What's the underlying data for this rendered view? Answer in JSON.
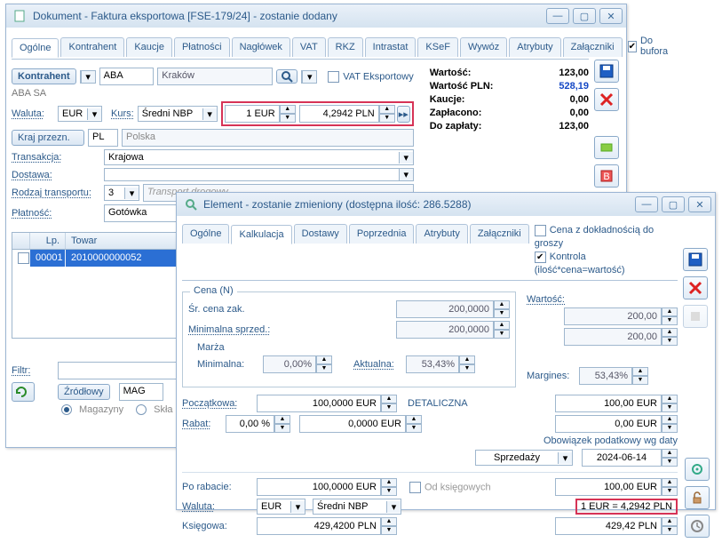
{
  "win1": {
    "title": "Dokument - Faktura eksportowa [FSE-179/24]  - zostanie dodany",
    "do_bufora_label": "Do bufora",
    "do_bufora_checked": true,
    "tabs": [
      "Ogólne",
      "Kontrahent",
      "Kaucje",
      "Płatności",
      "Nagłówek",
      "VAT",
      "RKZ",
      "Intrastat",
      "KSeF",
      "Wywóz",
      "Atrybuty",
      "Załączniki"
    ],
    "active_tab": 0,
    "kontrahent_btn": "Kontrahent",
    "kontrahent_value": "ABA",
    "kontrahent_city": "Kraków",
    "vat_eksportowy_label": "VAT Eksportowy",
    "aba_full": "ABA SA",
    "waluta_label": "Waluta:",
    "waluta_value": "EUR",
    "kurs_label": "Kurs:",
    "kurs_type": "Średni NBP",
    "kurs_amt": "1 EUR",
    "kurs_rate": "4,2942 PLN",
    "kraj_btn": "Kraj przezn.",
    "kraj_code": "PL",
    "kraj_name": "Polska",
    "transakcja_label": "Transakcja:",
    "transakcja_value": "Krajowa",
    "dostawa_label": "Dostawa:",
    "dostawa_value": "",
    "rodzaj_label": "Rodzaj transportu:",
    "rodzaj_value": "3",
    "rodzaj_desc": "Transport drogowy",
    "platnosc_label": "Płatność:",
    "platnosc_value": "Gotówka",
    "summary": {
      "wartosc_lbl": "Wartość:",
      "wartosc": "123,00",
      "wartosc_pln_lbl": "Wartość PLN:",
      "wartosc_pln": "528,19",
      "kaucje_lbl": "Kaucje:",
      "kaucje": "0,00",
      "zaplacono_lbl": "Zapłacono:",
      "zaplacono": "0,00",
      "do_zaplaty_lbl": "Do zapłaty:",
      "do_zaplaty": "123,00"
    },
    "grid": {
      "cols": {
        "lp": "Lp.",
        "towar": "Towar"
      },
      "row": {
        "lp": "00001",
        "towar": "2010000000052"
      }
    },
    "filtr_label": "Filtr:",
    "src_btn": "Źródłowy",
    "mag_label": "MAG",
    "magazyny_label": "Magazyny",
    "sklady_label": "Skła"
  },
  "win2": {
    "title": "Element - zostanie zmieniony (dostępna ilość: 286.5288)",
    "opt1_label": "Cena z dokładnością do groszy",
    "opt1_checked": false,
    "opt2_label": "Kontrola (ilość*cena=wartość)",
    "opt2_checked": true,
    "tabs": [
      "Ogólne",
      "Kalkulacja",
      "Dostawy",
      "Poprzednia",
      "Atrybuty",
      "Załączniki"
    ],
    "active_tab": 1,
    "cena_n_legend": "Cena (N)",
    "wartosc_lbl": "Wartość:",
    "sr_cena_lbl": "Śr. cena zak.",
    "sr_cena": "200,0000",
    "wartosc_val": "200,00",
    "min_sprzed_lbl": "Minimalna sprzed.:",
    "min_sprzed": "200,0000",
    "wartosc_val2": "200,00",
    "marza_lbl": "Marża",
    "minimalna_lbl": "Minimalna:",
    "minimalna_val": "0,00%",
    "aktualna_lbl": "Aktualna:",
    "aktualna_val": "53,43%",
    "margines_lbl": "Margines:",
    "margines_val": "53,43%",
    "poczatkowa_lbl": "Początkowa:",
    "poczatkowa_val": "100,0000 EUR",
    "detaliczna_lbl": "DETALICZNA",
    "detaliczna_val": "100,00 EUR",
    "rabat_lbl": "Rabat:",
    "rabat_pct": "0,00 %",
    "rabat_val": "0,0000 EUR",
    "rabat_right": "0,00 EUR",
    "obow_lbl": "Obowiązek podatkowy wg daty",
    "obow_select": "Sprzedaży",
    "obow_date": "2024-06-14",
    "po_rabacie_lbl": "Po rabacie:",
    "po_rabacie_val": "100,0000 EUR",
    "od_ksiegowych_lbl": "Od księgowych",
    "po_rabacie_right": "100,00 EUR",
    "waluta_lbl": "Waluta:",
    "waluta_val": "EUR",
    "waluta_kurs": "Średni NBP",
    "waluta_rate": "1 EUR  =  4,2942 PLN",
    "ksiegowa_lbl": "Księgowa:",
    "ksiegowa_val": "429,4200 PLN",
    "ksiegowa_right": "429,42 PLN"
  }
}
